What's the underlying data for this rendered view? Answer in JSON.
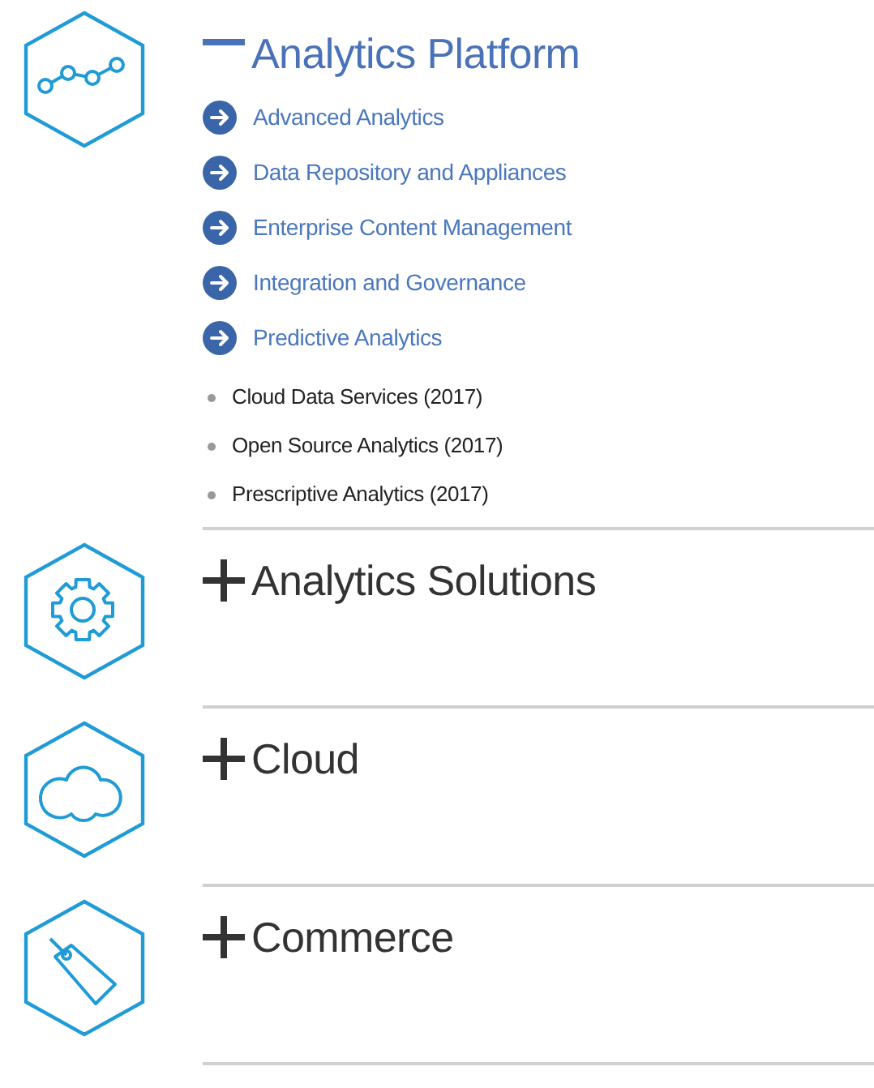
{
  "sections": [
    {
      "kind": "chart",
      "title": "Analytics Platform",
      "expanded": true,
      "links": [
        "Advanced Analytics",
        "Data Repository and Appliances",
        "Enterprise Content Management",
        "Integration and Governance",
        "Predictive Analytics"
      ],
      "items": [
        "Cloud Data Services (2017)",
        "Open Source Analytics (2017)",
        "Prescriptive Analytics (2017)"
      ]
    },
    {
      "kind": "gear",
      "title": "Analytics Solutions",
      "expanded": false
    },
    {
      "kind": "cloud",
      "title": "Cloud",
      "expanded": false
    },
    {
      "kind": "tag",
      "title": "Commerce",
      "expanded": false
    }
  ]
}
